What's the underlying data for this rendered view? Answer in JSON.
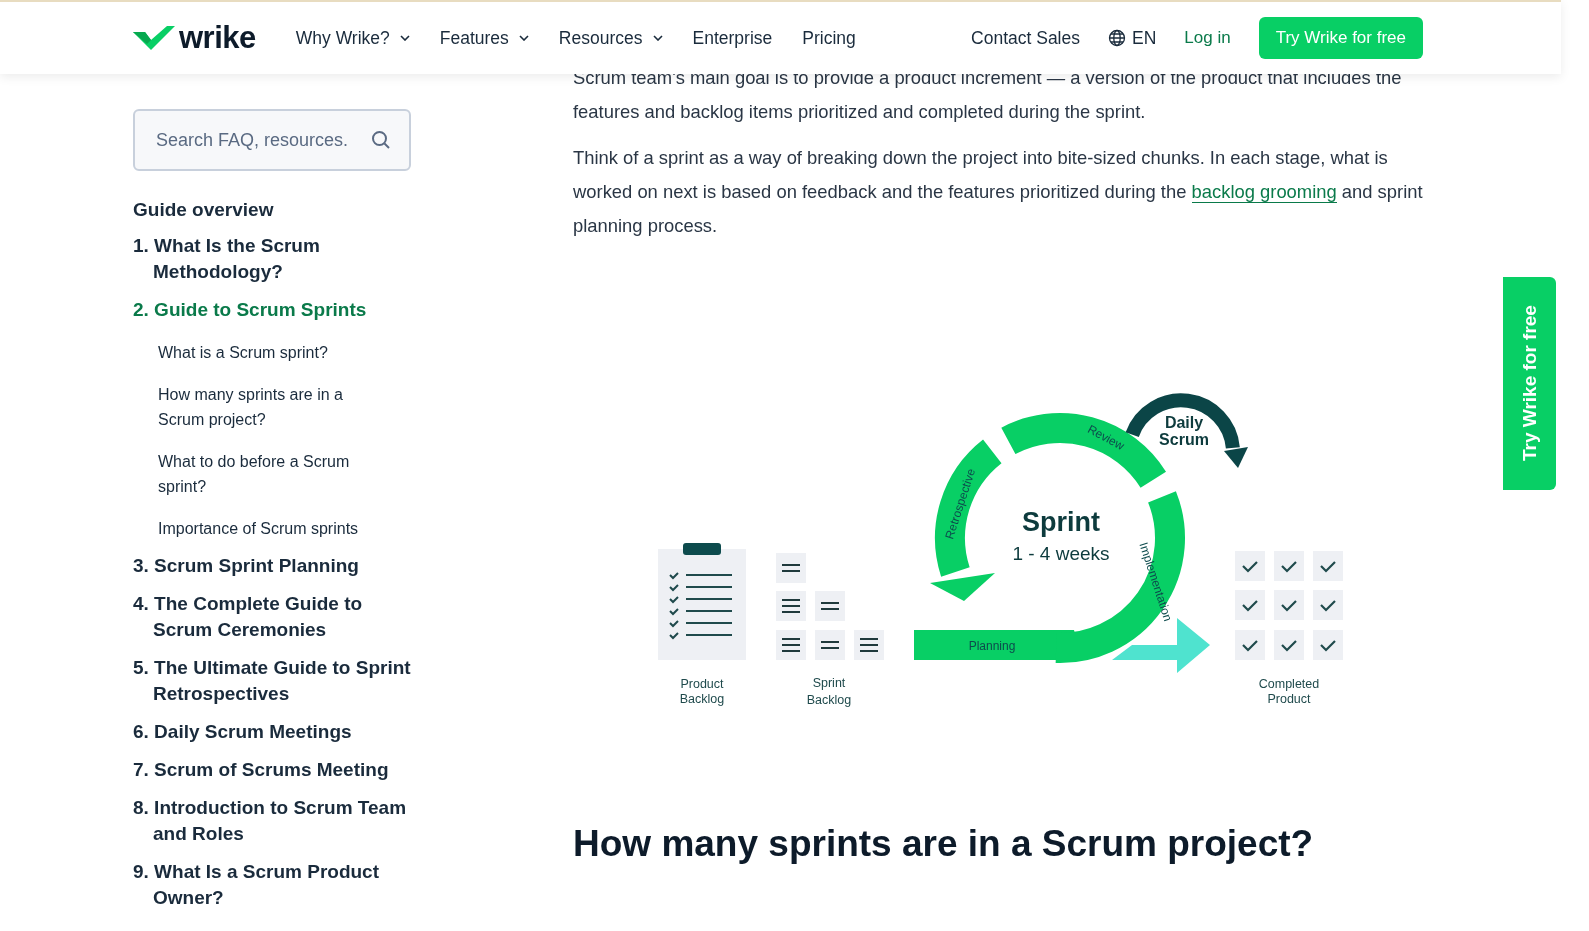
{
  "header": {
    "logo": "wrike",
    "nav": [
      {
        "label": "Why Wrike?",
        "dropdown": true
      },
      {
        "label": "Features",
        "dropdown": true
      },
      {
        "label": "Resources",
        "dropdown": true
      },
      {
        "label": "Enterprise",
        "dropdown": false
      },
      {
        "label": "Pricing",
        "dropdown": false
      }
    ],
    "contact": "Contact Sales",
    "language": "EN",
    "login": "Log in",
    "cta": "Try Wrike for free"
  },
  "sidebar": {
    "search": {
      "placeholder": "Search FAQ, resources."
    },
    "overview": "Guide overview",
    "items": [
      {
        "title": "1. What Is the Scrum Methodology?",
        "selected": false
      },
      {
        "title": "2. Guide to Scrum Sprints",
        "selected": true,
        "children": [
          {
            "title": "What is a Scrum sprint?"
          },
          {
            "title": "How many sprints are in a Scrum project?"
          },
          {
            "title": "What to do before a Scrum sprint?"
          },
          {
            "title": "Importance of Scrum sprints"
          }
        ]
      },
      {
        "title": "3. Scrum Sprint Planning",
        "selected": false
      },
      {
        "title": "4. The Complete Guide to Scrum Ceremonies",
        "selected": false
      },
      {
        "title": "5. The Ultimate Guide to Sprint Retrospectives",
        "selected": false
      },
      {
        "title": "6. Daily Scrum Meetings",
        "selected": false
      },
      {
        "title": "7. Scrum of Scrums Meeting",
        "selected": false
      },
      {
        "title": "8. Introduction to Scrum Team and Roles",
        "selected": false
      },
      {
        "title": "9. What Is a Scrum Product Owner?",
        "selected": false
      }
    ]
  },
  "article": {
    "paragraphs": [
      {
        "text": "Scrum team's main goal is to provide a product increment — a version of the product that includes the features and backlog items prioritized and completed during the sprint."
      },
      {
        "text": "Think of a sprint as a way of breaking down the project into bite-sized chunks. In each stage, what is worked on next is based on feedback and the features prioritized during the ",
        "link": "backlog grooming",
        "after": " and sprint planning process."
      }
    ],
    "diagram": {
      "title": "Sprint",
      "duration": "1 - 4 weeks",
      "daily": [
        "Daily",
        "Scrum"
      ],
      "review": "Review",
      "retrospective": "Retrospective",
      "implementation": "Implementation",
      "planning": "Planning",
      "product_backlog": [
        "Product",
        "Backlog"
      ],
      "sprint_backlog": [
        "Sprint",
        "Backlog"
      ],
      "completed": [
        "Completed",
        "Product"
      ]
    },
    "heading": "How many sprints are in a Scrum project?"
  },
  "side_tab": "Try Wrike for free"
}
